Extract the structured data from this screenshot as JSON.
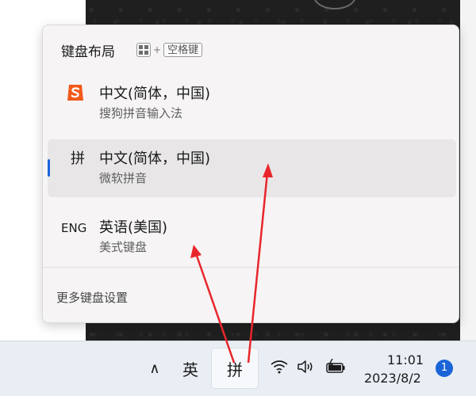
{
  "flyout": {
    "title": "键盘布局",
    "shortcut_plus": "+",
    "shortcut_space": "空格键",
    "items": [
      {
        "icon": "sogou-icon",
        "name": "中文(简体，中国)",
        "sub": "搜狗拼音输入法",
        "selected": false
      },
      {
        "icon_text": "拼",
        "name": "中文(简体，中国)",
        "sub": "微软拼音",
        "selected": true
      },
      {
        "icon_text": "ENG",
        "name": "英语(美国)",
        "sub": "美式键盘",
        "selected": false
      }
    ],
    "more_settings": "更多键盘设置"
  },
  "taskbar": {
    "chevron": "∧",
    "ying": "英",
    "pin": "拼",
    "time": "11:01",
    "date": "2023/8/2",
    "notification_count": "1"
  },
  "colors": {
    "accent": "#1b64d8",
    "annotation_arrow": "#e8262a",
    "sogou": "#f25a1b"
  }
}
